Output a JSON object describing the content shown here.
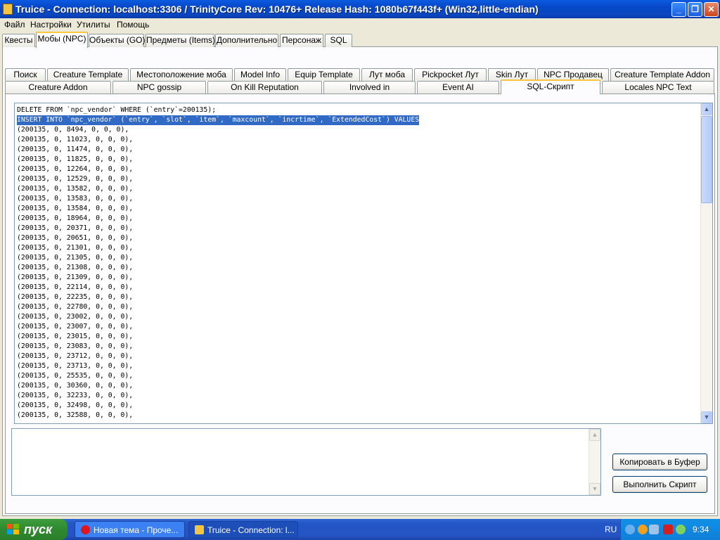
{
  "window": {
    "title": "Truice - Connection: localhost:3306 / TrinityCore Rev: 10476+ Release Hash: 1080b67f443f+ (Win32,little-endian)"
  },
  "menu": [
    "Файл",
    "Настройки",
    "Утилиты",
    "Помощь"
  ],
  "main_tabs": [
    "Квесты",
    "Мобы (NPC)",
    "Объекты (GO)",
    "Предметы (Items)",
    "Дополнительно",
    "Персонаж",
    "SQL"
  ],
  "sub_tabs_row1": [
    "Поиск",
    "Creature Template",
    "Местоположение моба",
    "Model Info",
    "Equip Template",
    "Лут моба",
    "Pickpocket Лут",
    "Skin Лут",
    "NPC Продавец",
    "Creature Template Addon"
  ],
  "sub_tabs_row2": [
    "Creature Addon",
    "NPC gossip",
    "On Kill Reputation",
    "Involved in",
    "Event AI",
    "SQL-Скрипт",
    "Locales NPC Text"
  ],
  "sql_lines": [
    "DELETE FROM `npc_vendor` WHERE (`entry`=200135);",
    "INSERT INTO `npc_vendor` (`entry`, `slot`, `item`, `maxcount`, `incrtime`, `ExtendedCost`) VALUES",
    "(200135, 0, 8494, 0, 0, 0),",
    "(200135, 0, 11023, 0, 0, 0),",
    "(200135, 0, 11474, 0, 0, 0),",
    "(200135, 0, 11825, 0, 0, 0),",
    "(200135, 0, 12264, 0, 0, 0),",
    "(200135, 0, 12529, 0, 0, 0),",
    "(200135, 0, 13582, 0, 0, 0),",
    "(200135, 0, 13583, 0, 0, 0),",
    "(200135, 0, 13584, 0, 0, 0),",
    "(200135, 0, 18964, 0, 0, 0),",
    "(200135, 0, 20371, 0, 0, 0),",
    "(200135, 0, 20651, 0, 0, 0),",
    "(200135, 0, 21301, 0, 0, 0),",
    "(200135, 0, 21305, 0, 0, 0),",
    "(200135, 0, 21308, 0, 0, 0),",
    "(200135, 0, 21309, 0, 0, 0),",
    "(200135, 0, 22114, 0, 0, 0),",
    "(200135, 0, 22235, 0, 0, 0),",
    "(200135, 0, 22780, 0, 0, 0),",
    "(200135, 0, 23002, 0, 0, 0),",
    "(200135, 0, 23007, 0, 0, 0),",
    "(200135, 0, 23015, 0, 0, 0),",
    "(200135, 0, 23083, 0, 0, 0),",
    "(200135, 0, 23712, 0, 0, 0),",
    "(200135, 0, 23713, 0, 0, 0),",
    "(200135, 0, 25535, 0, 0, 0),",
    "(200135, 0, 30360, 0, 0, 0),",
    "(200135, 0, 32233, 0, 0, 0),",
    "(200135, 0, 32498, 0, 0, 0),",
    "(200135, 0, 32588, 0, 0, 0),"
  ],
  "buttons": {
    "copy": "Копировать в Буфер",
    "run": "Выполнить Скрипт"
  },
  "taskbar": {
    "start": "пуск",
    "items": [
      "Новая тема - Проче...",
      "Truice - Connection: l..."
    ],
    "lang": "RU",
    "clock": "9:34"
  },
  "colors": {
    "titlebar": "#0a5ae0",
    "selection": "#316ac5",
    "tab_accent": "#ffc83c",
    "taskbar": "#245edb",
    "start": "#2f8a2f"
  }
}
